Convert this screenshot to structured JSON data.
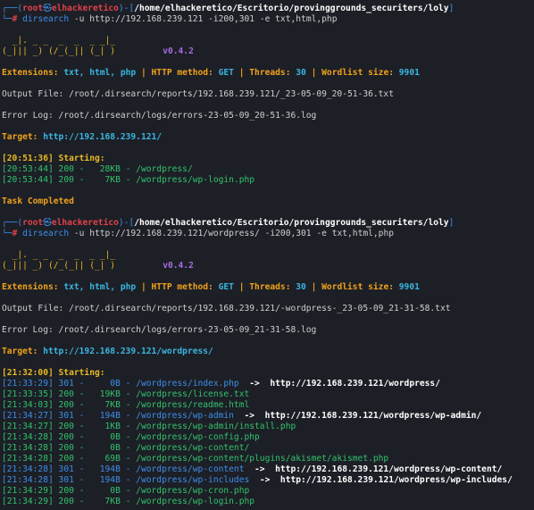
{
  "sessions": [
    {
      "prompt": {
        "open": "┌──(",
        "user": "root",
        "at": "㉿",
        "host": "elhackeretico",
        "mid": ")-[",
        "path": "/home/elhackeretico/Escritorio/provinggrounds_securiters/loly",
        "close": "]",
        "arrow": "└─",
        "hash": "# ",
        "cmd": "dirsearch",
        "args1": " -u ",
        "target": "http://192.168.239.121",
        "args2": " -i200,301 -e txt,html,php"
      },
      "logo": {
        "l1": "  _|. _ _  _  _  _ _|_    ",
        "l2": "(_||| _) (/_(_|| (_| )    ",
        "version": "v0.4.2"
      },
      "config": {
        "ext_label": "Extensions: ",
        "ext_value": "txt, html, php",
        "method_label": "HTTP method: ",
        "method_value": "GET",
        "threads_label": "Threads: ",
        "threads_value": "30",
        "wordlist_label": "Wordlist size: ",
        "wordlist_value": "9901",
        "sep": " | "
      },
      "output_file": "Output File: /root/.dirsearch/reports/192.168.239.121/_23-05-09_20-51-36.txt",
      "error_log": "Error Log: /root/.dirsearch/logs/errors-23-05-09_20-51-36.log",
      "target_label": "Target: ",
      "target_url": "http://192.168.239.121/",
      "starting": "[20:51:36] Starting:",
      "results": [
        {
          "time": "[20:53:44]",
          "code": "200",
          "size": "  28KB",
          "path": "/wordpress/",
          "redirect": ""
        },
        {
          "time": "[20:53:44]",
          "code": "200",
          "size": "   7KB",
          "path": "/wordpress/wp-login.php",
          "redirect": ""
        }
      ],
      "completed": "Task Completed"
    },
    {
      "prompt": {
        "open": "┌──(",
        "user": "root",
        "at": "㉿",
        "host": "elhackeretico",
        "mid": ")-[",
        "path": "/home/elhackeretico/Escritorio/provinggrounds_securiters/loly",
        "close": "]",
        "arrow": "└─",
        "hash": "# ",
        "cmd": "dirsearch",
        "args1": " -u ",
        "target": "http://192.168.239.121/wordpress/",
        "args2": " -i200,301 -e txt,html,php"
      },
      "logo": {
        "l1": "  _|. _ _  _  _  _ _|_    ",
        "l2": "(_||| _) (/_(_|| (_| )    ",
        "version": "v0.4.2"
      },
      "config": {
        "ext_label": "Extensions: ",
        "ext_value": "txt, html, php",
        "method_label": "HTTP method: ",
        "method_value": "GET",
        "threads_label": "Threads: ",
        "threads_value": "30",
        "wordlist_label": "Wordlist size: ",
        "wordlist_value": "9901",
        "sep": " | "
      },
      "output_file": "Output File: /root/.dirsearch/reports/192.168.239.121/-wordpress-_23-05-09_21-31-58.txt",
      "error_log": "Error Log: /root/.dirsearch/logs/errors-23-05-09_21-31-58.log",
      "target_label": "Target: ",
      "target_url": "http://192.168.239.121/wordpress/",
      "starting": "[21:32:00] Starting:",
      "results": [
        {
          "time": "[21:33:29]",
          "code": "301",
          "size": "    0B",
          "path": "/wordpress/index.php",
          "redirect": "http://192.168.239.121/wordpress/"
        },
        {
          "time": "[21:33:35]",
          "code": "200",
          "size": "  19KB",
          "path": "/wordpress/license.txt",
          "redirect": ""
        },
        {
          "time": "[21:34:03]",
          "code": "200",
          "size": "   7KB",
          "path": "/wordpress/readme.html",
          "redirect": ""
        },
        {
          "time": "[21:34:27]",
          "code": "301",
          "size": "  194B",
          "path": "/wordpress/wp-admin",
          "redirect": "http://192.168.239.121/wordpress/wp-admin/"
        },
        {
          "time": "[21:34:27]",
          "code": "200",
          "size": "   1KB",
          "path": "/wordpress/wp-admin/install.php",
          "redirect": ""
        },
        {
          "time": "[21:34:28]",
          "code": "200",
          "size": "    0B",
          "path": "/wordpress/wp-config.php",
          "redirect": ""
        },
        {
          "time": "[21:34:28]",
          "code": "200",
          "size": "    0B",
          "path": "/wordpress/wp-content/",
          "redirect": ""
        },
        {
          "time": "[21:34:28]",
          "code": "200",
          "size": "   69B",
          "path": "/wordpress/wp-content/plugins/akismet/akismet.php",
          "redirect": ""
        },
        {
          "time": "[21:34:28]",
          "code": "301",
          "size": "  194B",
          "path": "/wordpress/wp-content",
          "redirect": "http://192.168.239.121/wordpress/wp-content/"
        },
        {
          "time": "[21:34:28]",
          "code": "301",
          "size": "  194B",
          "path": "/wordpress/wp-includes",
          "redirect": "http://192.168.239.121/wordpress/wp-includes/"
        },
        {
          "time": "[21:34:29]",
          "code": "200",
          "size": "    0B",
          "path": "/wordpress/wp-cron.php",
          "redirect": ""
        },
        {
          "time": "[21:34:29]",
          "code": "200",
          "size": "   7KB",
          "path": "/wordpress/wp-login.php",
          "redirect": ""
        }
      ],
      "completed": ""
    }
  ],
  "colors": {
    "background": "#1d1f26",
    "prompt_blue": "#3b8eea",
    "user_red": "#e0414a",
    "info_orange": "#f0a21b",
    "url_cyan": "#39b6e0",
    "ok_green": "#31c26d",
    "logo_yellow": "#e8b923"
  }
}
